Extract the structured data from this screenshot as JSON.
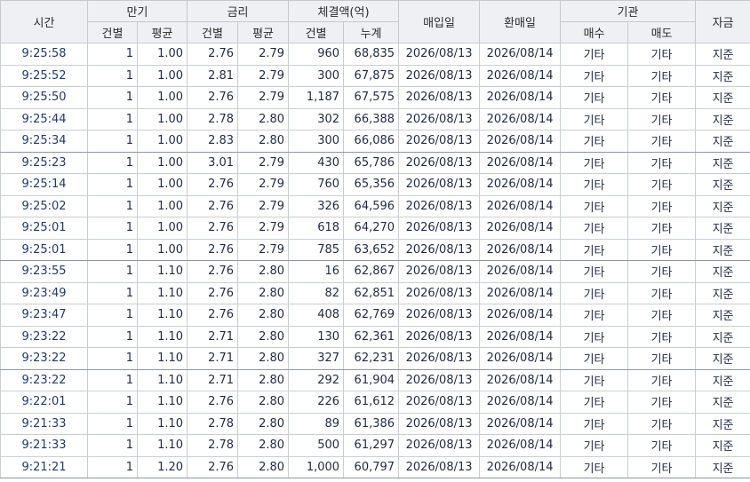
{
  "headers": {
    "time": "시간",
    "maturity": "만기",
    "rate": "금리",
    "amount": "체결액(억)",
    "buy_date": "매입일",
    "sell_date": "환매일",
    "institution": "기관",
    "fund": "자금",
    "count": "건별",
    "avg": "평균",
    "cumulative": "누계",
    "buy": "매수",
    "sell": "매도"
  },
  "rows": [
    {
      "time": "9:25:58",
      "mat_cnt": "1",
      "mat_avg": "1.00",
      "rate_cnt": "2.76",
      "rate_avg": "2.79",
      "amt_cnt": "960",
      "amt_cum": "68,835",
      "buy_date": "2026/08/13",
      "sell_date": "2026/08/14",
      "buyer": "기타",
      "seller": "기타",
      "fund": "지준"
    },
    {
      "time": "9:25:52",
      "mat_cnt": "1",
      "mat_avg": "1.00",
      "rate_cnt": "2.81",
      "rate_avg": "2.79",
      "amt_cnt": "300",
      "amt_cum": "67,875",
      "buy_date": "2026/08/13",
      "sell_date": "2026/08/14",
      "buyer": "기타",
      "seller": "기타",
      "fund": "지준"
    },
    {
      "time": "9:25:50",
      "mat_cnt": "1",
      "mat_avg": "1.00",
      "rate_cnt": "2.76",
      "rate_avg": "2.79",
      "amt_cnt": "1,187",
      "amt_cum": "67,575",
      "buy_date": "2026/08/13",
      "sell_date": "2026/08/14",
      "buyer": "기타",
      "seller": "기타",
      "fund": "지준"
    },
    {
      "time": "9:25:44",
      "mat_cnt": "1",
      "mat_avg": "1.00",
      "rate_cnt": "2.78",
      "rate_avg": "2.80",
      "amt_cnt": "302",
      "amt_cum": "66,388",
      "buy_date": "2026/08/13",
      "sell_date": "2026/08/14",
      "buyer": "기타",
      "seller": "기타",
      "fund": "지준"
    },
    {
      "time": "9:25:34",
      "mat_cnt": "1",
      "mat_avg": "1.00",
      "rate_cnt": "2.83",
      "rate_avg": "2.80",
      "amt_cnt": "300",
      "amt_cum": "66,086",
      "buy_date": "2026/08/13",
      "sell_date": "2026/08/14",
      "buyer": "기타",
      "seller": "기타",
      "fund": "지준"
    },
    {
      "time": "9:25:23",
      "mat_cnt": "1",
      "mat_avg": "1.00",
      "rate_cnt": "3.01",
      "rate_avg": "2.79",
      "amt_cnt": "430",
      "amt_cum": "65,786",
      "buy_date": "2026/08/13",
      "sell_date": "2026/08/14",
      "buyer": "기타",
      "seller": "기타",
      "fund": "지준"
    },
    {
      "time": "9:25:14",
      "mat_cnt": "1",
      "mat_avg": "1.00",
      "rate_cnt": "2.76",
      "rate_avg": "2.79",
      "amt_cnt": "760",
      "amt_cum": "65,356",
      "buy_date": "2026/08/13",
      "sell_date": "2026/08/14",
      "buyer": "기타",
      "seller": "기타",
      "fund": "지준"
    },
    {
      "time": "9:25:02",
      "mat_cnt": "1",
      "mat_avg": "1.00",
      "rate_cnt": "2.76",
      "rate_avg": "2.79",
      "amt_cnt": "326",
      "amt_cum": "64,596",
      "buy_date": "2026/08/13",
      "sell_date": "2026/08/14",
      "buyer": "기타",
      "seller": "기타",
      "fund": "지준"
    },
    {
      "time": "9:25:01",
      "mat_cnt": "1",
      "mat_avg": "1.00",
      "rate_cnt": "2.76",
      "rate_avg": "2.79",
      "amt_cnt": "618",
      "amt_cum": "64,270",
      "buy_date": "2026/08/13",
      "sell_date": "2026/08/14",
      "buyer": "기타",
      "seller": "기타",
      "fund": "지준"
    },
    {
      "time": "9:25:01",
      "mat_cnt": "1",
      "mat_avg": "1.00",
      "rate_cnt": "2.76",
      "rate_avg": "2.79",
      "amt_cnt": "785",
      "amt_cum": "63,652",
      "buy_date": "2026/08/13",
      "sell_date": "2026/08/14",
      "buyer": "기타",
      "seller": "기타",
      "fund": "지준"
    },
    {
      "time": "9:23:55",
      "mat_cnt": "1",
      "mat_avg": "1.10",
      "rate_cnt": "2.76",
      "rate_avg": "2.80",
      "amt_cnt": "16",
      "amt_cum": "62,867",
      "buy_date": "2026/08/13",
      "sell_date": "2026/08/14",
      "buyer": "기타",
      "seller": "기타",
      "fund": "지준"
    },
    {
      "time": "9:23:49",
      "mat_cnt": "1",
      "mat_avg": "1.10",
      "rate_cnt": "2.76",
      "rate_avg": "2.80",
      "amt_cnt": "82",
      "amt_cum": "62,851",
      "buy_date": "2026/08/13",
      "sell_date": "2026/08/14",
      "buyer": "기타",
      "seller": "기타",
      "fund": "지준"
    },
    {
      "time": "9:23:47",
      "mat_cnt": "1",
      "mat_avg": "1.10",
      "rate_cnt": "2.76",
      "rate_avg": "2.80",
      "amt_cnt": "408",
      "amt_cum": "62,769",
      "buy_date": "2026/08/13",
      "sell_date": "2026/08/14",
      "buyer": "기타",
      "seller": "기타",
      "fund": "지준"
    },
    {
      "time": "9:23:22",
      "mat_cnt": "1",
      "mat_avg": "1.10",
      "rate_cnt": "2.71",
      "rate_avg": "2.80",
      "amt_cnt": "130",
      "amt_cum": "62,361",
      "buy_date": "2026/08/13",
      "sell_date": "2026/08/14",
      "buyer": "기타",
      "seller": "기타",
      "fund": "지준"
    },
    {
      "time": "9:23:22",
      "mat_cnt": "1",
      "mat_avg": "1.10",
      "rate_cnt": "2.71",
      "rate_avg": "2.80",
      "amt_cnt": "327",
      "amt_cum": "62,231",
      "buy_date": "2026/08/13",
      "sell_date": "2026/08/14",
      "buyer": "기타",
      "seller": "기타",
      "fund": "지준"
    },
    {
      "time": "9:23:22",
      "mat_cnt": "1",
      "mat_avg": "1.10",
      "rate_cnt": "2.71",
      "rate_avg": "2.80",
      "amt_cnt": "292",
      "amt_cum": "61,904",
      "buy_date": "2026/08/13",
      "sell_date": "2026/08/14",
      "buyer": "기타",
      "seller": "기타",
      "fund": "지준"
    },
    {
      "time": "9:22:01",
      "mat_cnt": "1",
      "mat_avg": "1.10",
      "rate_cnt": "2.76",
      "rate_avg": "2.80",
      "amt_cnt": "226",
      "amt_cum": "61,612",
      "buy_date": "2026/08/13",
      "sell_date": "2026/08/14",
      "buyer": "기타",
      "seller": "기타",
      "fund": "지준"
    },
    {
      "time": "9:21:33",
      "mat_cnt": "1",
      "mat_avg": "1.10",
      "rate_cnt": "2.78",
      "rate_avg": "2.80",
      "amt_cnt": "89",
      "amt_cum": "61,386",
      "buy_date": "2026/08/13",
      "sell_date": "2026/08/14",
      "buyer": "기타",
      "seller": "기타",
      "fund": "지준"
    },
    {
      "time": "9:21:33",
      "mat_cnt": "1",
      "mat_avg": "1.10",
      "rate_cnt": "2.78",
      "rate_avg": "2.80",
      "amt_cnt": "500",
      "amt_cum": "61,297",
      "buy_date": "2026/08/13",
      "sell_date": "2026/08/14",
      "buyer": "기타",
      "seller": "기타",
      "fund": "지준"
    },
    {
      "time": "9:21:21",
      "mat_cnt": "1",
      "mat_avg": "1.20",
      "rate_cnt": "2.76",
      "rate_avg": "2.80",
      "amt_cnt": "1,000",
      "amt_cum": "60,797",
      "buy_date": "2026/08/13",
      "sell_date": "2026/08/14",
      "buyer": "기타",
      "seller": "기타",
      "fund": "지준"
    }
  ]
}
